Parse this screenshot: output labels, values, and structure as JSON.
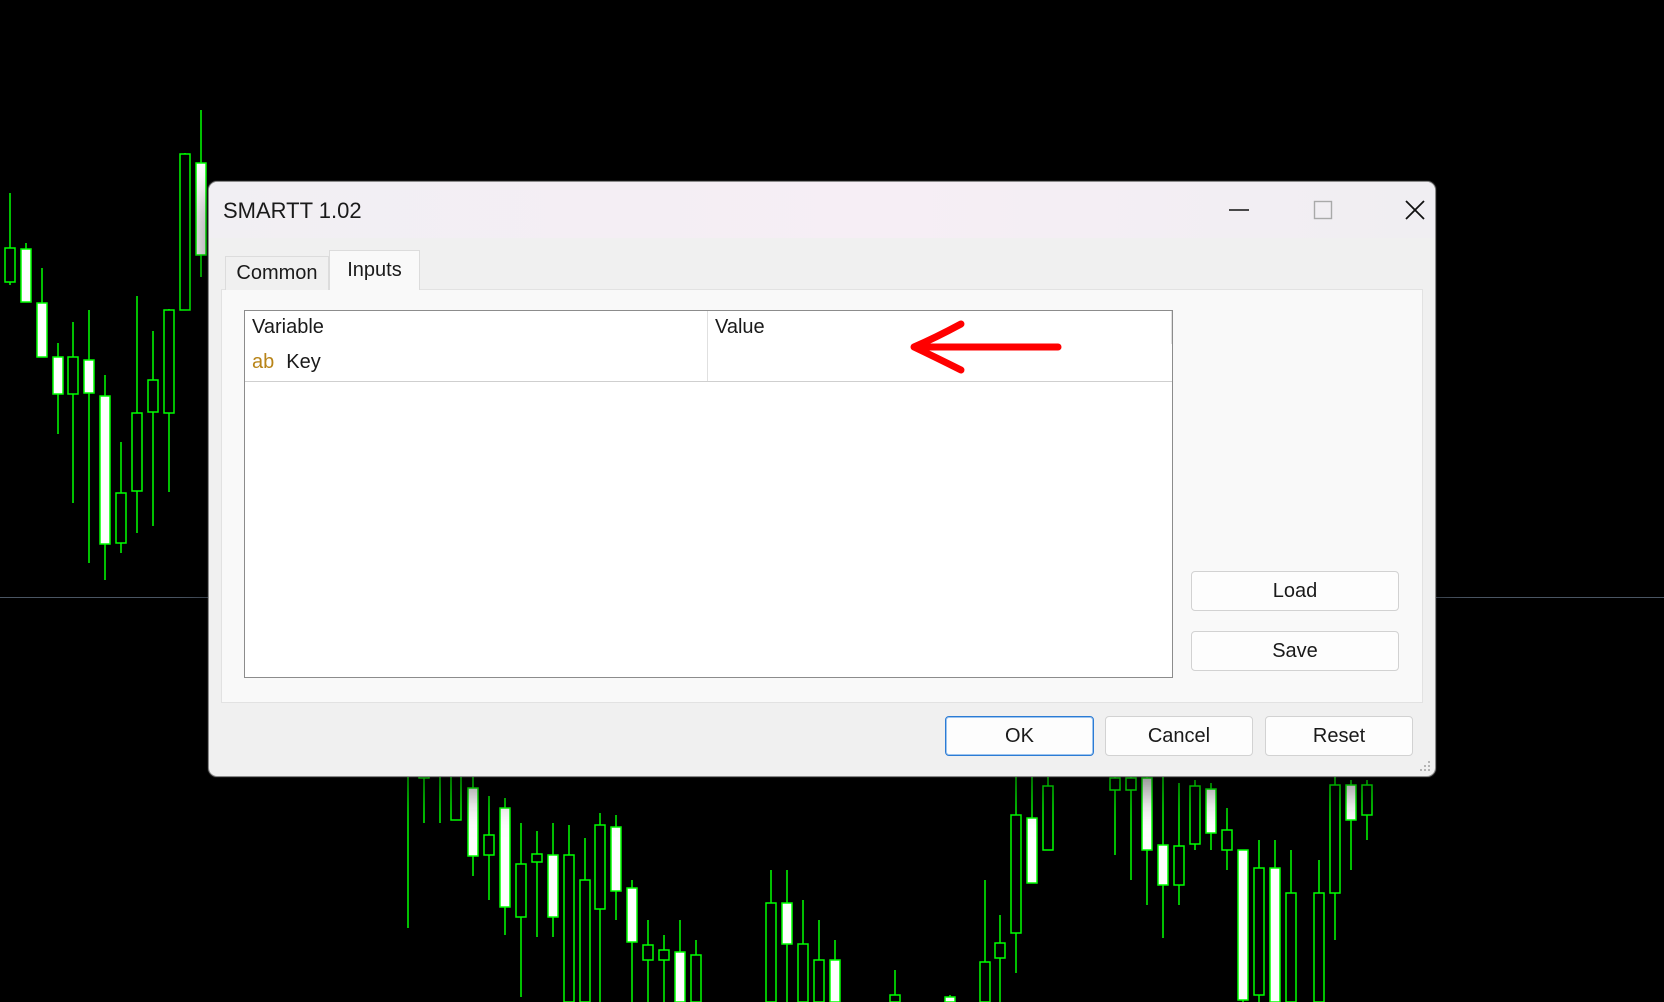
{
  "dialog": {
    "title": "SMARTT 1.02",
    "tabs": [
      {
        "label": "Common",
        "active": false
      },
      {
        "label": "Inputs",
        "active": true
      }
    ]
  },
  "grid": {
    "columns": [
      "Variable",
      "Value"
    ],
    "rows": [
      {
        "type_icon": "ab",
        "variable": "Key",
        "value": ""
      }
    ]
  },
  "buttons": {
    "load": "Load",
    "save": "Save",
    "ok": "OK",
    "cancel": "Cancel",
    "reset": "Reset"
  },
  "colors": {
    "chart_background": "#000000",
    "candle_up": "#00ff00",
    "candle_body_fill": "#ffffff",
    "annotation_arrow": "#ff0000",
    "string_icon": "#b88418",
    "ok_border": "#2b7bd4"
  },
  "icons": {
    "minimize": "minimize-icon",
    "maximize": "maximize-icon",
    "close": "close-icon",
    "resize_grip": "resize-grip-icon",
    "annotation": "red-arrow-icon"
  }
}
